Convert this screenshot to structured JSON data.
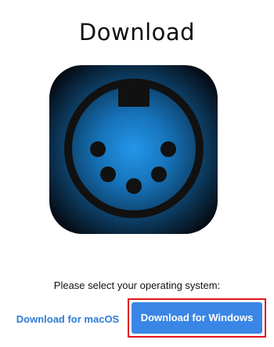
{
  "header": {
    "title": "Download"
  },
  "app_icon": {
    "icon": "midi-din-connector-icon",
    "colors": {
      "background_center": "#1e90e6",
      "background_edge": "#060a10",
      "foreground": "#111111"
    }
  },
  "os_selection": {
    "prompt": "Please select your operating system:",
    "mac_button_label": "Download for macOS",
    "windows_button_label": "Download for Windows"
  },
  "colors": {
    "link": "#2f7cd8",
    "primary_button": "#3a86e6",
    "highlight": "#e0161e"
  }
}
